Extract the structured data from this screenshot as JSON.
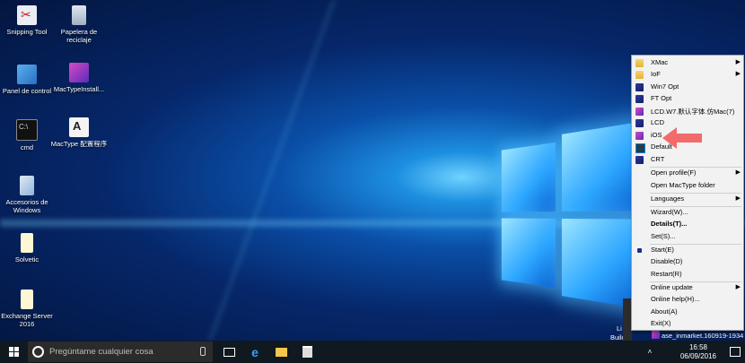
{
  "desktop": {
    "icons": [
      {
        "label": "Snipping Tool",
        "icon": "scissors-icon"
      },
      {
        "label": "Papelera de reciclaje",
        "icon": "recycle-bin-icon"
      },
      {
        "label": "Panel de control",
        "icon": "control-panel-icon"
      },
      {
        "label": "MacTypeInstall...",
        "icon": "mactype-installer-icon"
      },
      {
        "label": "cmd",
        "icon": "cmd-icon"
      },
      {
        "label": "MacType 配置程序",
        "icon": "mactype-config-icon"
      },
      {
        "label": "Accesorios de Windows",
        "icon": "folder-accessories-icon"
      },
      {
        "label": "Solvetic",
        "icon": "document-icon"
      },
      {
        "label": "Exchange Server 2016",
        "icon": "document-icon"
      }
    ],
    "partial_text": {
      "li": "Li",
      "build": "Build",
      "tray_tooltip": "ase_inmarket.160919-1934"
    }
  },
  "context_menu": {
    "items": [
      {
        "label": "XMac",
        "icon": "folder-icon",
        "submenu": true
      },
      {
        "label": "IoF",
        "icon": "folder-icon",
        "submenu": true
      },
      {
        "label": "Win7 Opt",
        "icon": "mactype-icon"
      },
      {
        "label": "FT Opt",
        "icon": "mactype-icon"
      },
      {
        "label": "LCD.W7.默认字体.仿Mac(7)",
        "icon": "mactype-icon"
      },
      {
        "label": "LCD",
        "icon": "mactype-icon"
      },
      {
        "label": "iOS",
        "icon": "mactype-pink-icon"
      },
      {
        "label": "Default",
        "icon": "monitor-icon"
      },
      {
        "label": "CRT",
        "icon": "mactype-icon"
      },
      {
        "label": "Open profile(F)",
        "submenu": true
      },
      {
        "label": "Open MacType folder"
      },
      {
        "label": "Languages",
        "submenu": true
      },
      {
        "label": "Wizard(W)..."
      },
      {
        "label": "Details(T)...",
        "bold": true
      },
      {
        "label": "Set(S)..."
      },
      {
        "label": "Start(E)",
        "checked": true
      },
      {
        "label": "Disable(D)"
      },
      {
        "label": "Restart(R)"
      },
      {
        "label": "Online update",
        "submenu": true
      },
      {
        "label": "Online help(H)..."
      },
      {
        "label": "About(A)"
      },
      {
        "label": "Exit(X)"
      }
    ]
  },
  "taskbar": {
    "search_placeholder": "Pregúntame cualquier cosa",
    "time": "16:58",
    "date": "06/09/2016",
    "apps": [
      "task-view-icon",
      "edge-icon",
      "file-explorer-icon",
      "store-icon"
    ]
  },
  "colors": {
    "accent": "#0078d7",
    "menu_bg": "#f2f2f2",
    "taskbar_bg": "#101820",
    "annotation_arrow": "#f26b6b"
  }
}
